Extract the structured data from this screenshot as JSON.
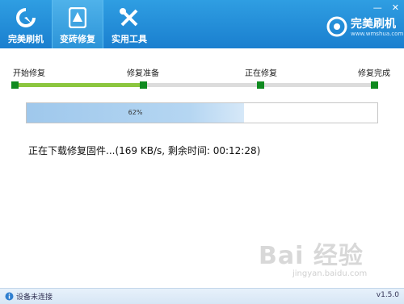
{
  "window": {
    "controls": {
      "minimize": "—",
      "close": "✕"
    }
  },
  "nav": {
    "tabs": [
      {
        "label": "完美刷机",
        "icon": "refresh-arrow-icon",
        "active": false
      },
      {
        "label": "变砖修复",
        "icon": "phone-warning-icon",
        "active": true
      },
      {
        "label": "实用工具",
        "icon": "wrench-screwdriver-icon",
        "active": false
      }
    ]
  },
  "brand": {
    "name": "完美刷机",
    "url": "www.wmshua.com"
  },
  "steps": {
    "items": [
      "开始修复",
      "修复准备",
      "正在修复",
      "修复完成"
    ],
    "completed": 2,
    "current": 2,
    "colors": {
      "done": "#8cc63f",
      "pending": "#dcdcdc",
      "marker": "#0f8a1f"
    }
  },
  "progress": {
    "percent": 62,
    "label": "62%"
  },
  "status_text": "正在下载修复固件...(169 KB/s, 剩余时间: 00:12:28)",
  "watermark": {
    "main": "Bai 经验",
    "sub": "jingyan.baidu.com"
  },
  "footer": {
    "device_status": "设备未连接",
    "version": "v1.5.0"
  },
  "colors": {
    "header": "#1a7fcf",
    "accent": "#2f9ee2"
  }
}
